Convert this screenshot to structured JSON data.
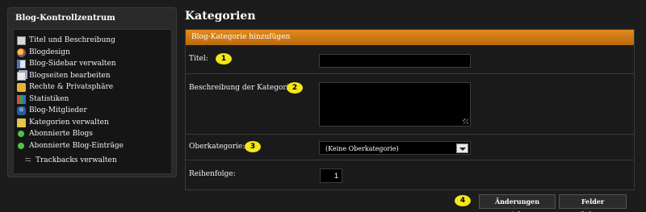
{
  "sidebar": {
    "title": "Blog-Kontrollzentrum",
    "items": [
      {
        "label": "Titel und Beschreibung",
        "icon": "document-icon"
      },
      {
        "label": "Blogdesign",
        "icon": "palette-icon"
      },
      {
        "label": "Blog-Sidebar verwalten",
        "icon": "sidebar-icon"
      },
      {
        "label": "Blogseiten bearbeiten",
        "icon": "pages-icon"
      },
      {
        "label": "Rechte & Privatsphäre",
        "icon": "lock-icon"
      },
      {
        "label": "Statistiken",
        "icon": "chart-icon"
      },
      {
        "label": "Blog-Mitglieder",
        "icon": "users-icon"
      },
      {
        "label": "Kategorien verwalten",
        "icon": "folder-icon"
      },
      {
        "label": "Abonnierte Blogs",
        "icon": "green-dot-icon"
      },
      {
        "label": "Abonnierte Blog-Einträge",
        "icon": "green-dot-icon"
      },
      {
        "label": "Trackbacks verwalten",
        "icon": "trackback-icon"
      }
    ]
  },
  "page": {
    "title": "Kategorien"
  },
  "form": {
    "header": "Blog-Kategorie hinzufügen",
    "title_label": "Titel:",
    "title_value": "",
    "description_label": "Beschreibung der Kategorie:",
    "description_value": "",
    "parent_label": "Oberkategorie:",
    "parent_selected": "(Keine Oberkategorie)",
    "order_label": "Reihenfolge:",
    "order_value": "1"
  },
  "badges": {
    "b1": "1",
    "b2": "2",
    "b3": "3",
    "b4": "4"
  },
  "buttons": {
    "save": "Änderungen speichern",
    "reset": "Felder zurücksetzen"
  },
  "colors": {
    "accent": "#d8821a",
    "badge": "#f3e61a",
    "background": "#1c1c1c"
  }
}
